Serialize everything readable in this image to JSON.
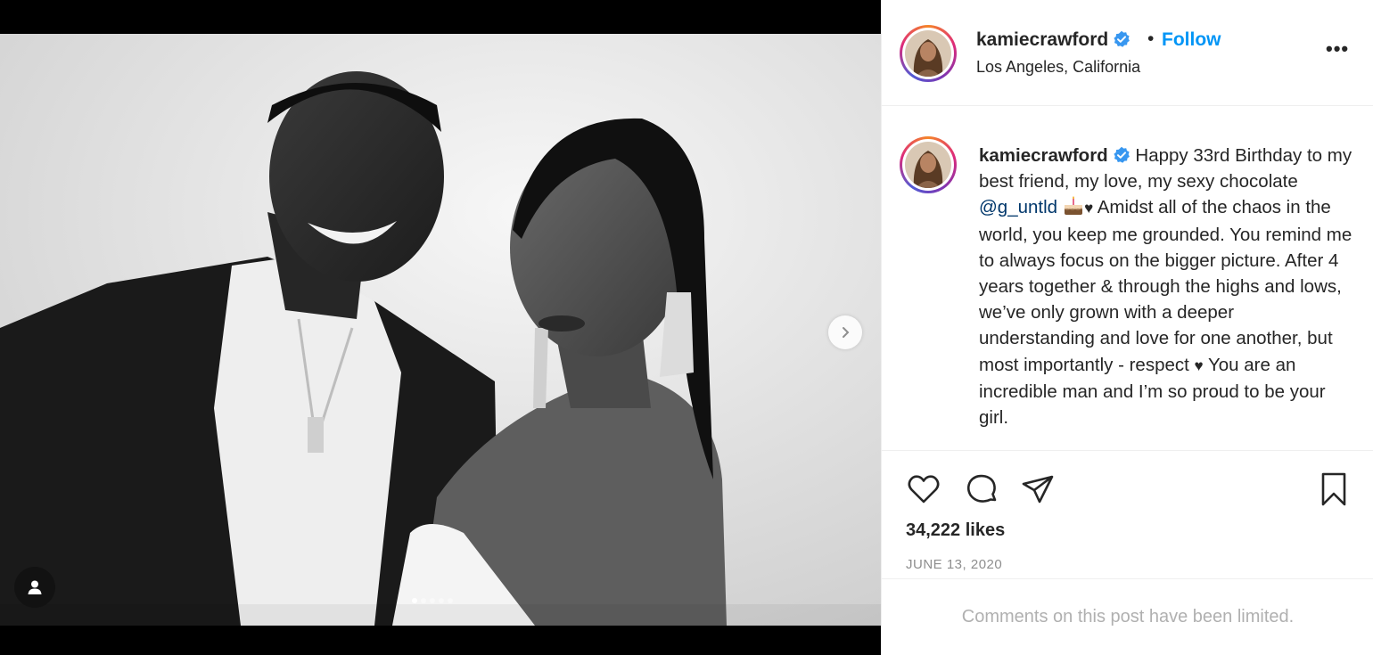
{
  "post": {
    "username": "kamiecrawford",
    "follow_label": "Follow",
    "separator": "•",
    "location": "Los Angeles, California",
    "more_label": "•••"
  },
  "caption": {
    "username": "kamiecrawford",
    "text_before_mention": "Happy 33rd Birthday to my best friend, my love, my sexy chocolate",
    "mention": "@g_untld",
    "heart": "♥",
    "text_after_mention": "Amidst all of the chaos in the world, you keep me grounded. You remind me to always focus on the bigger picture. After 4 years together & through the highs and lows, we’ve only grown with a deeper understanding and love for one another, but most importantly - respect",
    "text_end": "You are an incredible man and I’m so proud to be your girl."
  },
  "stats": {
    "likes": "34,222 likes",
    "date": "JUNE 13, 2020"
  },
  "footer": {
    "limited_text": "Comments on this post have been limited."
  },
  "carousel": {
    "dot_count": 5,
    "active_index": 0
  },
  "icons": {
    "verified": "verified-badge-icon",
    "like": "heart-icon",
    "comment": "comment-icon",
    "share": "send-icon",
    "save": "bookmark-icon",
    "next": "chevron-right-icon",
    "tags": "user-tag-icon"
  },
  "colors": {
    "follow": "#0095f6",
    "mention": "#00376b",
    "verified": "#3897f0",
    "muted": "#8e8e8e"
  }
}
